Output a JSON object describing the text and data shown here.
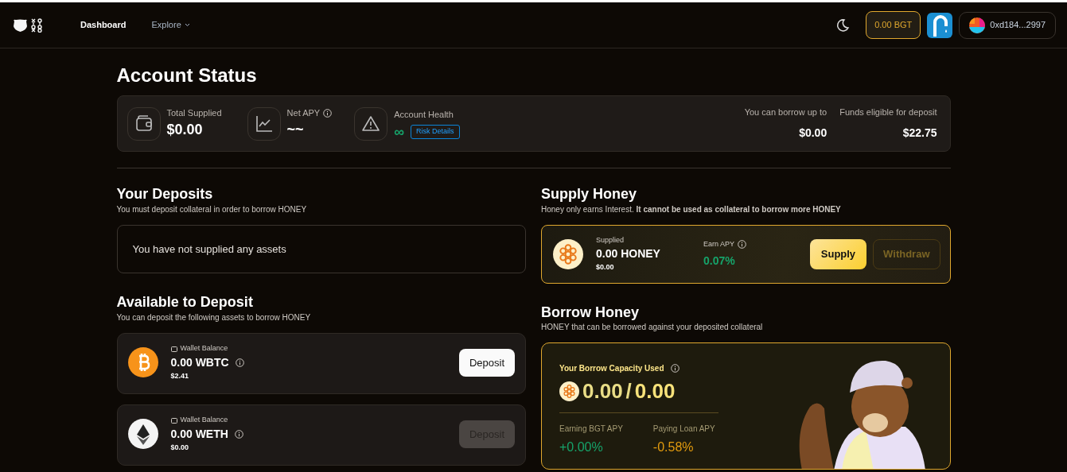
{
  "navbar": {
    "nav_items": [
      {
        "label": "Dashboard",
        "selected": true,
        "dropdown": false
      },
      {
        "label": "Explore",
        "selected": false,
        "dropdown": true
      }
    ],
    "bgt_balance": "0.00 BGT",
    "wallet_address": "0xd184...2997"
  },
  "account_status": {
    "title": "Account Status",
    "stats": [
      {
        "kind": "wallet",
        "label": "Total Supplied",
        "value": "$0.00",
        "info": false
      },
      {
        "kind": "chart",
        "label": "Net APY",
        "value": "~~",
        "info": true
      },
      {
        "kind": "health",
        "label": "Account Health",
        "value": "∞",
        "link": "Risk Details"
      }
    ],
    "summary": [
      {
        "label": "You can borrow up to",
        "value": "$0.00"
      },
      {
        "label": "Funds eligible for deposit",
        "value": "$22.75"
      }
    ]
  },
  "your_deposits": {
    "title": "Your Deposits",
    "subtitle": "You must deposit collateral in order to borrow HONEY",
    "empty_message": "You have not supplied any assets"
  },
  "available_to_deposit": {
    "title": "Available to Deposit",
    "subtitle": "You can deposit the following assets to borrow HONEY",
    "assets": [
      {
        "kind": "btc",
        "balance_label": "Wallet Balance",
        "amount": "0.00 WBTC",
        "usd": "$2.41",
        "button": "Deposit",
        "disabled": false
      },
      {
        "kind": "eth",
        "balance_label": "Wallet Balance",
        "amount": "0.00 WETH",
        "usd": "$0.00",
        "button": "Deposit",
        "disabled": true
      }
    ]
  },
  "supply_honey": {
    "title": "Supply Honey",
    "subtitle": "Honey only earns Interest. **It cannot be used as collateral to borrow more HONEY**",
    "supplied_label": "Supplied",
    "amount": "0.00 HONEY",
    "usd": "$0.00",
    "apy_label": "Earn APY",
    "apy": "0.07%",
    "buttons": [
      {
        "label": "Supply",
        "disabled": false,
        "kind": "primary"
      },
      {
        "label": "Withdraw",
        "disabled": true,
        "kind": "outline"
      }
    ]
  },
  "borrow_honey": {
    "title": "Borrow Honey",
    "subtitle": "HONEY that can be borrowed against your deposited collateral",
    "capacity_label": "Your Borrow Capacity Used",
    "used": "0.00",
    "separator": "/",
    "total": "0.00",
    "metrics": [
      {
        "label": "Earning BGT APY",
        "value": "+0.00%",
        "color": "#16a36a"
      },
      {
        "label": "Paying Loan APY",
        "value": "-0.58%",
        "color": "#e29b0e"
      }
    ]
  }
}
